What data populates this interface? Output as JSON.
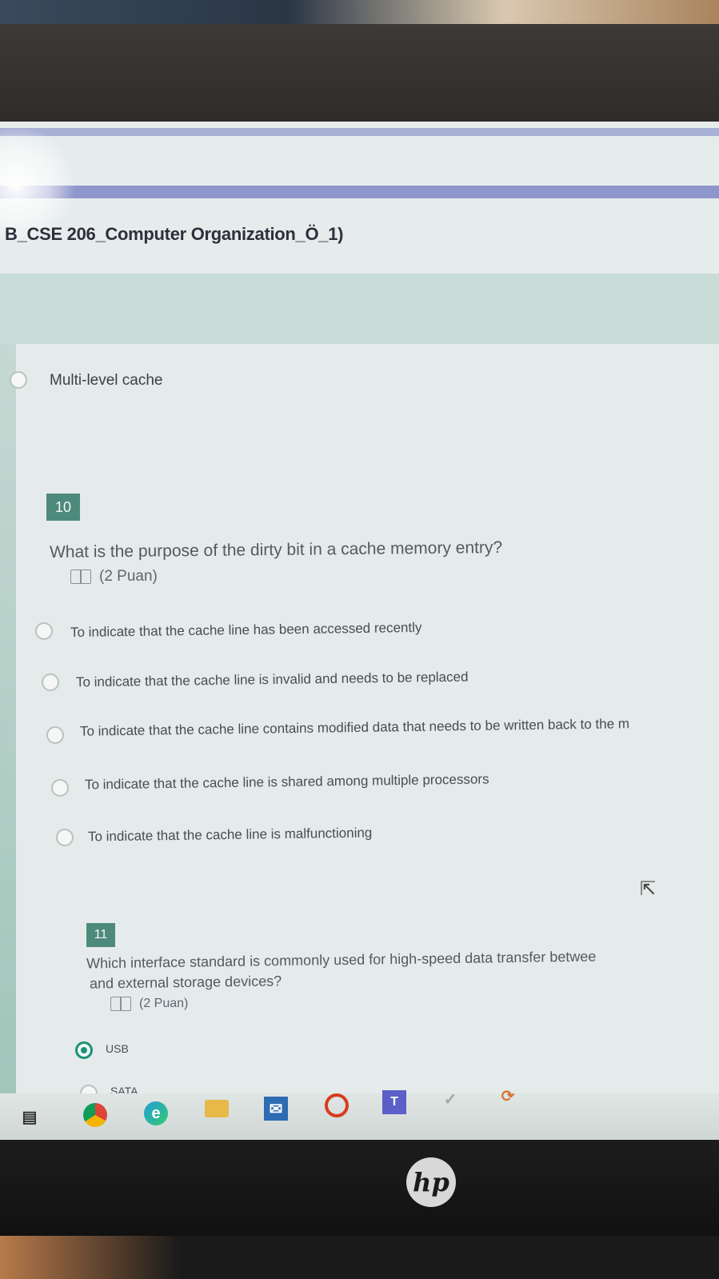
{
  "page_title": "B_CSE 206_Computer Organization_Ö_1)",
  "previous_option": {
    "label": "Multi-level cache"
  },
  "question10": {
    "number": "10",
    "text": "What is the purpose of the dirty bit in a cache memory entry?",
    "points": "(2 Puan)",
    "options": [
      "To indicate that the cache line has been accessed recently",
      "To indicate that the cache line is invalid and needs to be replaced",
      "To indicate that the cache line contains modified data that needs to be written back to the m",
      "To indicate that the cache line is shared among multiple processors",
      "To indicate that the cache line is malfunctioning"
    ]
  },
  "question11": {
    "number": "11",
    "text_line1": "Which interface standard is commonly used for high-speed data transfer betwee",
    "text_line2": "and external storage devices?",
    "points": "(2 Puan)",
    "options": [
      {
        "label": "USB",
        "selected": true
      },
      {
        "label": "SATA",
        "selected": false
      }
    ]
  },
  "brand": {
    "logo": "hp"
  },
  "taskbar_icons": [
    "task-view-icon",
    "chrome-icon",
    "edge-icon",
    "file-explorer-icon",
    "mail-icon",
    "office-icon",
    "teams-icon",
    "app-icon",
    "app-icon-2"
  ],
  "colors": {
    "accent": "#1b9277",
    "qnum_bg": "#4e8a7b",
    "header_stripe": "#8f96cb"
  }
}
